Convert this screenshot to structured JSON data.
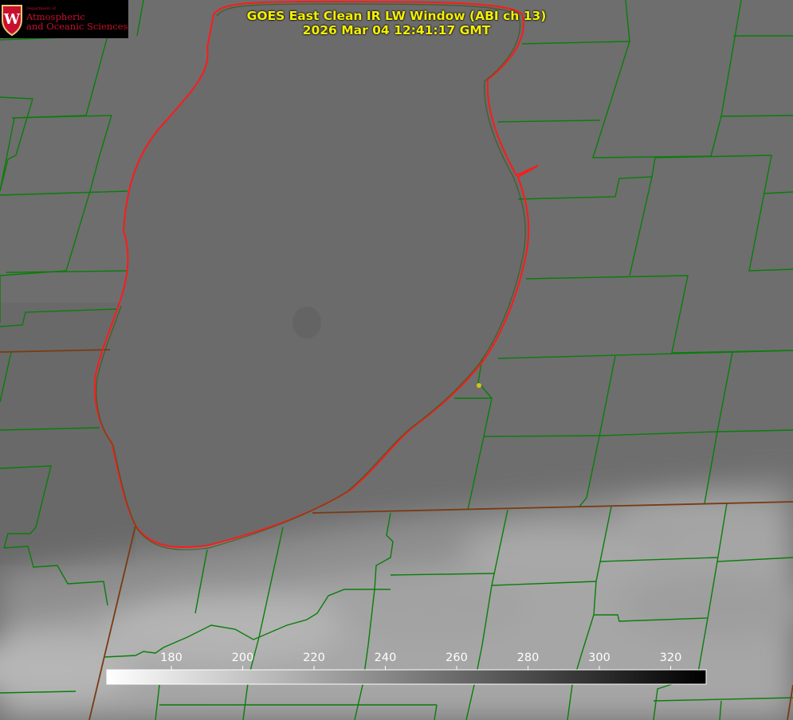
{
  "title": "GOES East Clean IR LW Window (ABI ch 13)",
  "timestamp": "2026 Mar 04 12:41:17 GMT",
  "logo": {
    "crest_letter": "W",
    "department_line": "Department of",
    "name_line1": "Atmospheric",
    "name_line2": "and Oceanic Sciences"
  },
  "colorbar": {
    "ticks": [
      "180",
      "200",
      "220",
      "240",
      "260",
      "280",
      "300",
      "320"
    ],
    "colors": {
      "low": "#ffffff",
      "high": "#000000"
    }
  },
  "map_colors": {
    "boundaries": "#0a7d0a",
    "coastline": "#ff1a1a",
    "state_line": "#7a3a12",
    "site_marker": "#d4c21a",
    "title_text": "#f5f000"
  }
}
